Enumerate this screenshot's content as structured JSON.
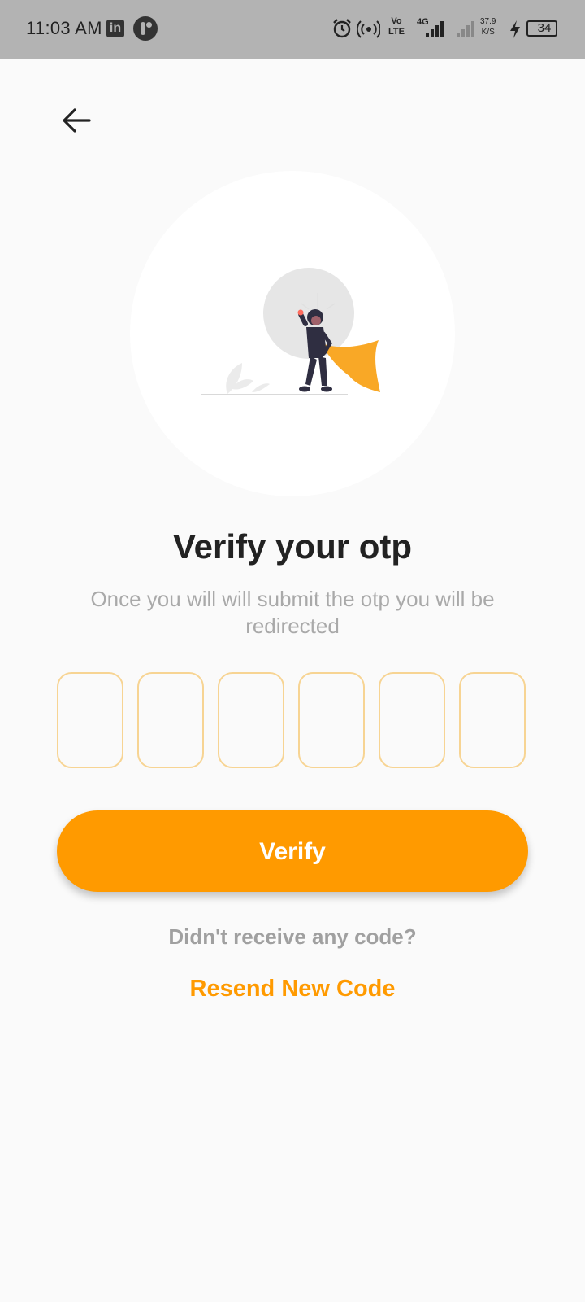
{
  "status_bar": {
    "time": "11:03 AM",
    "linkedin_icon_text": "in",
    "network_speed_value": "37.9",
    "network_speed_unit": "K/S",
    "battery_level": "34",
    "network_labels": [
      "Vo LTE",
      "4G"
    ],
    "icons": [
      "linkedin-icon",
      "app-icon",
      "alarm-icon",
      "hotspot-icon",
      "volte-icon",
      "signal-icon",
      "signal-icon-2",
      "charging-icon",
      "battery-icon"
    ]
  },
  "header": {
    "back_icon": "arrow-left-icon"
  },
  "hero": {
    "illustration": "superhero-woman-cape",
    "accent_color": "#f9a826"
  },
  "main": {
    "title": "Verify your otp",
    "subtitle": "Once you will will submit the otp you will be redirected",
    "otp": {
      "length": 6,
      "values": [
        "",
        "",
        "",
        "",
        "",
        ""
      ],
      "border_color": "#f7d493"
    },
    "verify_label": "Verify",
    "no_code_text": "Didn't receive any code?",
    "resend_label": "Resend New Code",
    "accent_color": "#ff9a00"
  }
}
